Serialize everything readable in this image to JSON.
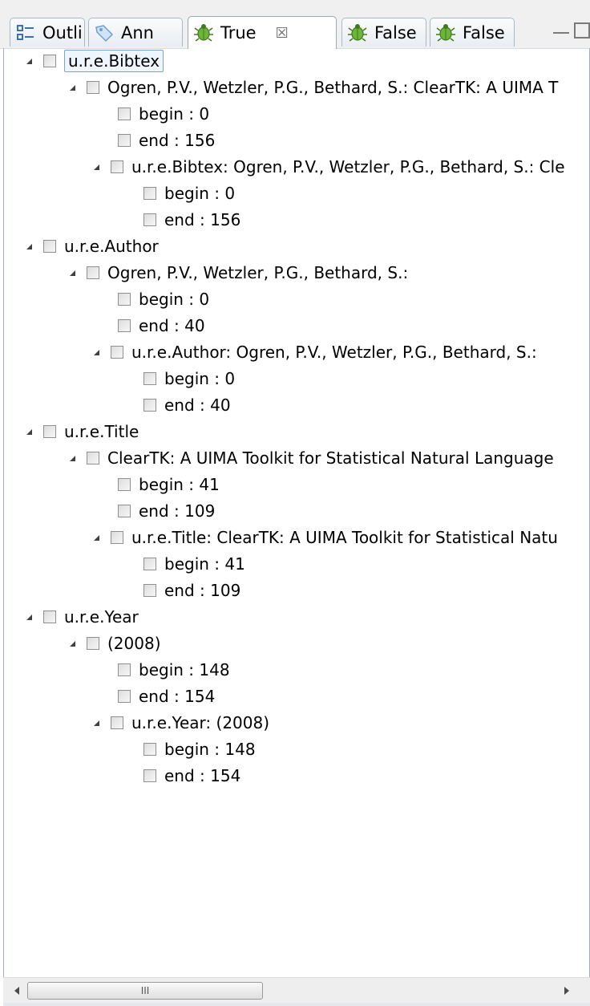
{
  "tabs": [
    {
      "label": "Outli",
      "icon": "outline-icon",
      "active": false
    },
    {
      "label": "Ann",
      "icon": "annotation-tag-icon",
      "active": false
    },
    {
      "label": "True",
      "icon": "bug-icon",
      "active": true,
      "close_glyph": "☒"
    },
    {
      "label": "False",
      "icon": "bug-icon",
      "active": false
    },
    {
      "label": "False",
      "icon": "bug-icon",
      "active": false
    }
  ],
  "tree": [
    {
      "label": "u.r.e.Bibtex",
      "selected": true
    },
    {
      "label": "Ogren, P.V., Wetzler, P.G., Bethard, S.: ClearTK: A UIMA T"
    },
    {
      "label": "begin : 0"
    },
    {
      "label": "end : 156"
    },
    {
      "label": "u.r.e.Bibtex: Ogren, P.V., Wetzler, P.G., Bethard, S.: Cle"
    },
    {
      "label": "begin : 0"
    },
    {
      "label": "end : 156"
    },
    {
      "label": "u.r.e.Author"
    },
    {
      "label": "Ogren, P.V., Wetzler, P.G., Bethard, S.:"
    },
    {
      "label": "begin : 0"
    },
    {
      "label": "end : 40"
    },
    {
      "label": "u.r.e.Author: Ogren, P.V., Wetzler, P.G., Bethard, S.:"
    },
    {
      "label": "begin : 0"
    },
    {
      "label": "end : 40"
    },
    {
      "label": "u.r.e.Title"
    },
    {
      "label": "ClearTK: A UIMA Toolkit for Statistical Natural Language"
    },
    {
      "label": "begin : 41"
    },
    {
      "label": "end : 109"
    },
    {
      "label": "u.r.e.Title: ClearTK: A UIMA Toolkit for Statistical Natu"
    },
    {
      "label": "begin : 41"
    },
    {
      "label": "end : 109"
    },
    {
      "label": "u.r.e.Year"
    },
    {
      "label": "(2008)"
    },
    {
      "label": "begin : 148"
    },
    {
      "label": "end : 154"
    },
    {
      "label": "u.r.e.Year: (2008)"
    },
    {
      "label": "begin : 148"
    },
    {
      "label": "end : 154"
    }
  ],
  "scrollbar": {
    "thumb_grip": "III"
  },
  "colors": {
    "selection_border": "#7da2ce",
    "bug_icon_green": "#4c9a2a"
  }
}
